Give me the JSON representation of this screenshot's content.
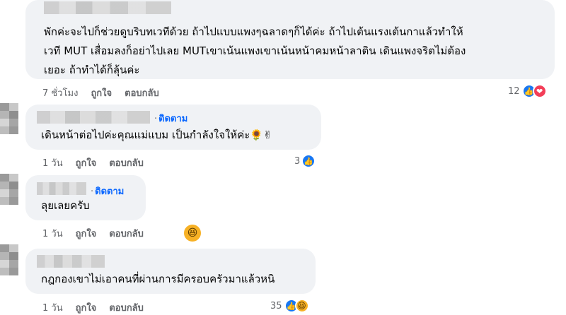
{
  "comments": [
    {
      "text_lines": [
        "พักค่ะจะไปก็ช่วยดูบริบทเวทีด้วย ถ้าไปแบบแพงๆฉลาดๆก็ได้ค่ะ ถ้าไปเต้นแรงเต้นกาแล้วทำให้",
        "เวที MUT เสื่อมลงก็อย่าไปเลย MUTเขาเน้นแพงเขาเน้นหน้าคมหน้าลาติน เดินแพงจริตไม่ต้อง",
        "เยอะ ถ้าทำได้ก็ลุ้นค่ะ"
      ],
      "time": "7 ชั่วโมง",
      "like_label": "ถูกใจ",
      "reply_label": "ตอบกลับ",
      "reaction_count": "12"
    },
    {
      "follow_label": "ติดตาม",
      "text": "เดินหน้าต่อไปค่ะคุณแม่แบม เป็นกำลังใจให้ค่ะ🌻✌",
      "time": "1 วัน",
      "like_label": "ถูกใจ",
      "reply_label": "ตอบกลับ",
      "reaction_count": "3"
    },
    {
      "follow_label": "ติดตาม",
      "text": "ลุยเลยครับ",
      "time": "1 วัน",
      "like_label": "ถูกใจ",
      "reply_label": "ตอบกลับ"
    },
    {
      "text": "กฎกองเขาไม่เอาคนที่ผ่านการมีครอบครัวมาแล้วหนิ",
      "time": "1 วัน",
      "like_label": "ถูกใจ",
      "reply_label": "ตอบกลับ",
      "reaction_count": "35"
    }
  ],
  "colors": {
    "bubble": "#f0f2f5",
    "follow": "#0866ff",
    "meta": "#65676b",
    "like": "#1877f2",
    "love": "#f33e58",
    "haha": "#f7b125"
  },
  "icons": [
    "like-icon",
    "love-icon",
    "haha-icon"
  ]
}
